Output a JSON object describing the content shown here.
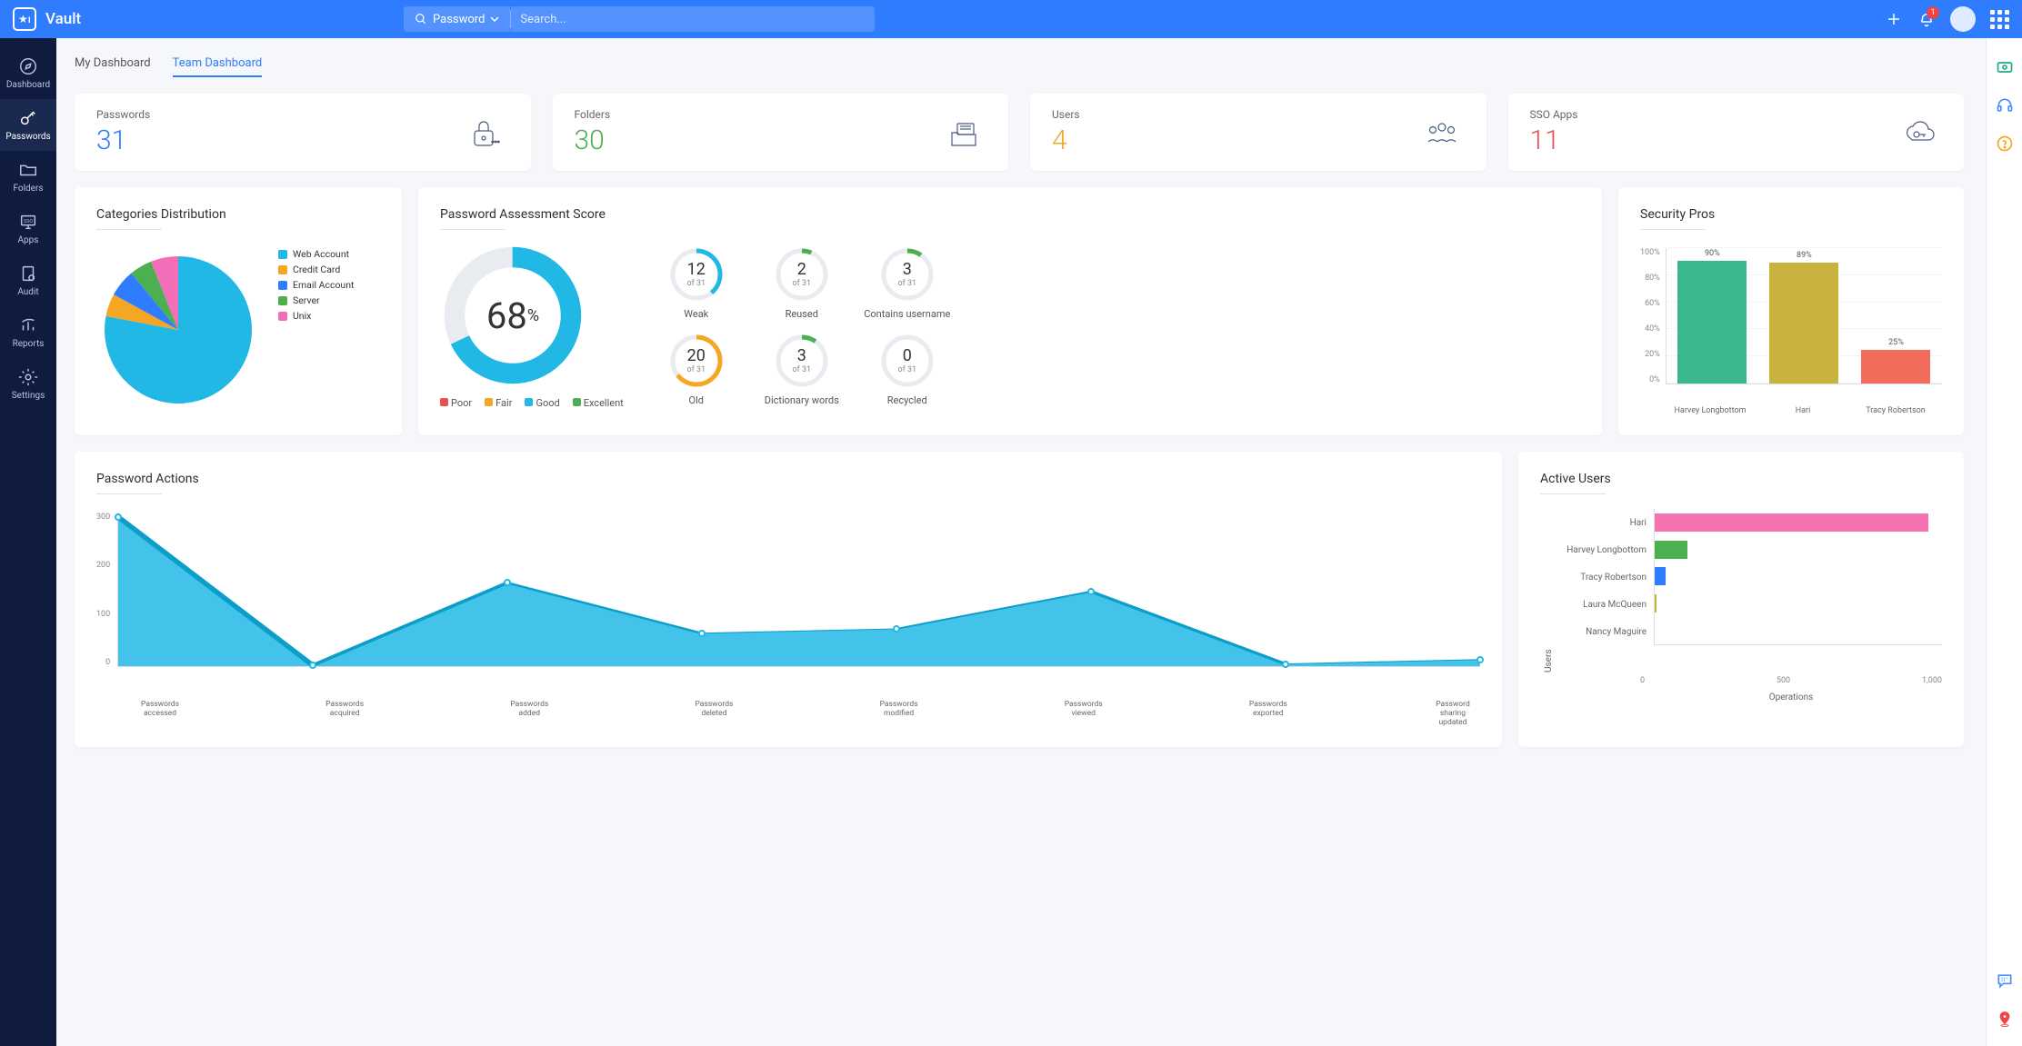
{
  "brand": "Vault",
  "header": {
    "search_category": "Password",
    "search_placeholder": "Search...",
    "notification_count": "1"
  },
  "sidenav": [
    {
      "label": "Dashboard"
    },
    {
      "label": "Passwords"
    },
    {
      "label": "Folders"
    },
    {
      "label": "Apps"
    },
    {
      "label": "Audit"
    },
    {
      "label": "Reports"
    },
    {
      "label": "Settings"
    }
  ],
  "tabs": {
    "my": "My Dashboard",
    "team": "Team Dashboard"
  },
  "stats": {
    "passwords": {
      "label": "Passwords",
      "value": "31",
      "color": "#2f7cff"
    },
    "folders": {
      "label": "Folders",
      "value": "30",
      "color": "#4cb050"
    },
    "users": {
      "label": "Users",
      "value": "4",
      "color": "#f5a623"
    },
    "sso": {
      "label": "SSO Apps",
      "value": "11",
      "color": "#e94f4f"
    }
  },
  "categories": {
    "title": "Categories Distribution",
    "items": [
      {
        "label": "Web Account",
        "color": "#22b8e6",
        "pct": 78
      },
      {
        "label": "Credit Card",
        "color": "#f5a623",
        "pct": 5
      },
      {
        "label": "Email Account",
        "color": "#2f7cff",
        "pct": 6
      },
      {
        "label": "Server",
        "color": "#4cb050",
        "pct": 5
      },
      {
        "label": "Unix",
        "color": "#f26fb7",
        "pct": 6
      }
    ]
  },
  "assessment": {
    "title": "Password Assessment Score",
    "score": "68",
    "pct": "%",
    "legend": [
      {
        "label": "Poor",
        "color": "#e94f4f"
      },
      {
        "label": "Fair",
        "color": "#f5a623"
      },
      {
        "label": "Good",
        "color": "#22b8e6"
      },
      {
        "label": "Excellent",
        "color": "#4cb050"
      }
    ],
    "metrics": [
      {
        "label": "Weak",
        "num": "12",
        "of": "of 31",
        "color": "#22b8e6",
        "frac": 0.39
      },
      {
        "label": "Reused",
        "num": "2",
        "of": "of 31",
        "color": "#4cb050",
        "frac": 0.065
      },
      {
        "label": "Contains username",
        "num": "3",
        "of": "of 31",
        "color": "#4cb050",
        "frac": 0.097
      },
      {
        "label": "Old",
        "num": "20",
        "of": "of 31",
        "color": "#f5a623",
        "frac": 0.645
      },
      {
        "label": "Dictionary words",
        "num": "3",
        "of": "of 31",
        "color": "#4cb050",
        "frac": 0.097
      },
      {
        "label": "Recycled",
        "num": "0",
        "of": "of 31",
        "color": "#4cb050",
        "frac": 0.0
      }
    ]
  },
  "security_pros": {
    "title": "Security Pros",
    "ylabels": [
      "100%",
      "80%",
      "60%",
      "40%",
      "20%",
      "0%"
    ],
    "bars": [
      {
        "label": "Harvey Longbottom",
        "pct": 90,
        "text": "90%",
        "color": "#3bb78f"
      },
      {
        "label": "Hari",
        "pct": 89,
        "text": "89%",
        "color": "#c9b23e"
      },
      {
        "label": "Tracy Robertson",
        "pct": 25,
        "text": "25%",
        "color": "#f26b5b"
      }
    ]
  },
  "actions": {
    "title": "Password Actions",
    "ylabels": [
      "300",
      "200",
      "100",
      "0"
    ],
    "series": [
      {
        "label": "Passwords accessed",
        "v": 340
      },
      {
        "label": "Passwords acquired",
        "v": 2
      },
      {
        "label": "Passwords added",
        "v": 190
      },
      {
        "label": "Passwords deleted",
        "v": 75
      },
      {
        "label": "Passwords modified",
        "v": 85
      },
      {
        "label": "Passwords viewed",
        "v": 170
      },
      {
        "label": "Passwords exported",
        "v": 5
      },
      {
        "label": "Password sharing updated",
        "v": 15
      }
    ]
  },
  "active_users": {
    "title": "Active Users",
    "axis_y": "Users",
    "axis_x": "Operations",
    "xlabels": [
      "0",
      "500",
      "1,000"
    ],
    "bars": [
      {
        "label": "Hari",
        "v": 1000,
        "color": "#f572b0"
      },
      {
        "label": "Harvey Longbottom",
        "v": 120,
        "color": "#4cb050"
      },
      {
        "label": "Tracy Robertson",
        "v": 40,
        "color": "#2f7cff"
      },
      {
        "label": "Laura McQueen",
        "v": 8,
        "color": "#c9b23e"
      },
      {
        "label": "Nancy Maguire",
        "v": 0,
        "color": "#22b8e6"
      }
    ]
  },
  "chart_data": [
    {
      "type": "pie",
      "title": "Categories Distribution",
      "series": [
        {
          "name": "Web Account",
          "value": 78
        },
        {
          "name": "Credit Card",
          "value": 5
        },
        {
          "name": "Email Account",
          "value": 6
        },
        {
          "name": "Server",
          "value": 5
        },
        {
          "name": "Unix",
          "value": 6
        }
      ]
    },
    {
      "type": "bar",
      "title": "Security Pros",
      "categories": [
        "Harvey Longbottom",
        "Hari",
        "Tracy Robertson"
      ],
      "values": [
        90,
        89,
        25
      ],
      "ylabel": "%",
      "ylim": [
        0,
        100
      ]
    },
    {
      "type": "area",
      "title": "Password Actions",
      "categories": [
        "Passwords accessed",
        "Passwords acquired",
        "Passwords added",
        "Passwords deleted",
        "Passwords modified",
        "Passwords viewed",
        "Passwords exported",
        "Password sharing updated"
      ],
      "values": [
        340,
        2,
        190,
        75,
        85,
        170,
        5,
        15
      ],
      "ylim": [
        0,
        350
      ]
    },
    {
      "type": "bar",
      "title": "Active Users",
      "orientation": "horizontal",
      "categories": [
        "Hari",
        "Harvey Longbottom",
        "Tracy Robertson",
        "Laura McQueen",
        "Nancy Maguire"
      ],
      "values": [
        1000,
        120,
        40,
        8,
        0
      ],
      "xlabel": "Operations",
      "ylabel": "Users"
    }
  ]
}
